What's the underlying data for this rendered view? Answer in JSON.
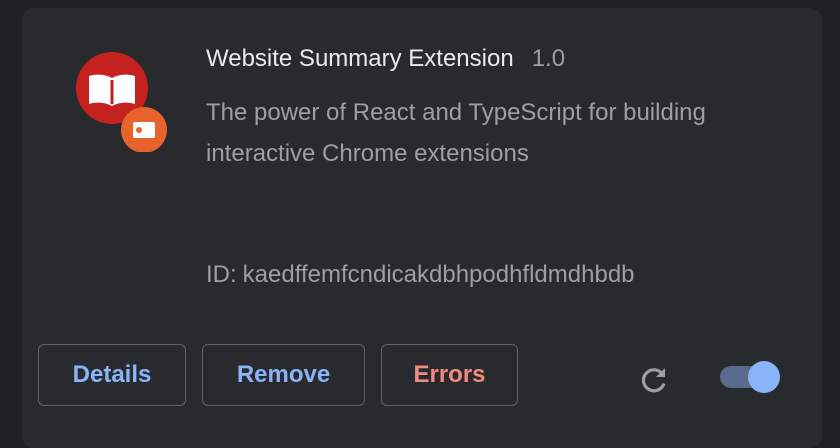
{
  "extension": {
    "name": "Website Summary Extension",
    "version": "1.0",
    "description": "The power of React and TypeScript for building interactive Chrome extensions",
    "id_label": "ID:",
    "id": "kaedffemfcndicakdbhpodhfldmdhbdb",
    "icon": "open-book-icon",
    "badge_icon": "camera-badge-icon",
    "icon_color": "#c5221f",
    "badge_color": "#e8622c"
  },
  "actions": {
    "details_label": "Details",
    "remove_label": "Remove",
    "errors_label": "Errors",
    "reload_icon": "reload-icon"
  },
  "toggle": {
    "enabled": true,
    "accent": "#8ab4f8"
  },
  "colors": {
    "card_background": "#292a2d",
    "link_blue": "#8ab4f8",
    "error_red": "#f28b82",
    "secondary_text": "#9aa0a6"
  }
}
